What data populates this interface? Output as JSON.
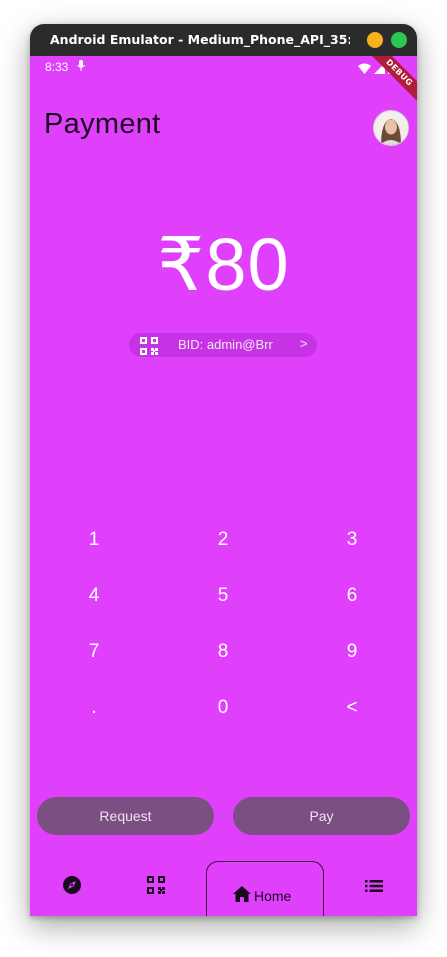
{
  "window": {
    "title": "Android Emulator - Medium_Phone_API_35:..."
  },
  "status_bar": {
    "time": "8:33",
    "debug_banner": "DEBUG"
  },
  "app_bar": {
    "title": "Payment",
    "avatar_icon": "user-avatar"
  },
  "payment": {
    "amount": "₹80",
    "bid_label": "BID: admin@Brr",
    "bid_chevron": ">"
  },
  "keypad": {
    "keys": [
      "1",
      "2",
      "3",
      "4",
      "5",
      "6",
      "7",
      "8",
      "9",
      ".",
      "0",
      "<"
    ]
  },
  "actions": {
    "request_label": "Request",
    "pay_label": "Pay"
  },
  "bottom_nav": {
    "items": [
      {
        "icon": "compass-icon",
        "label": ""
      },
      {
        "icon": "qr-code-icon",
        "label": ""
      },
      {
        "icon": "home-icon",
        "label": "Home",
        "selected": true
      },
      {
        "icon": "list-icon",
        "label": ""
      }
    ]
  },
  "colors": {
    "screen_background": "#e040fb",
    "button_background": "#7b4f81",
    "titlebar": "#2b2b2b",
    "debug_ribbon": "#b01c3c"
  }
}
